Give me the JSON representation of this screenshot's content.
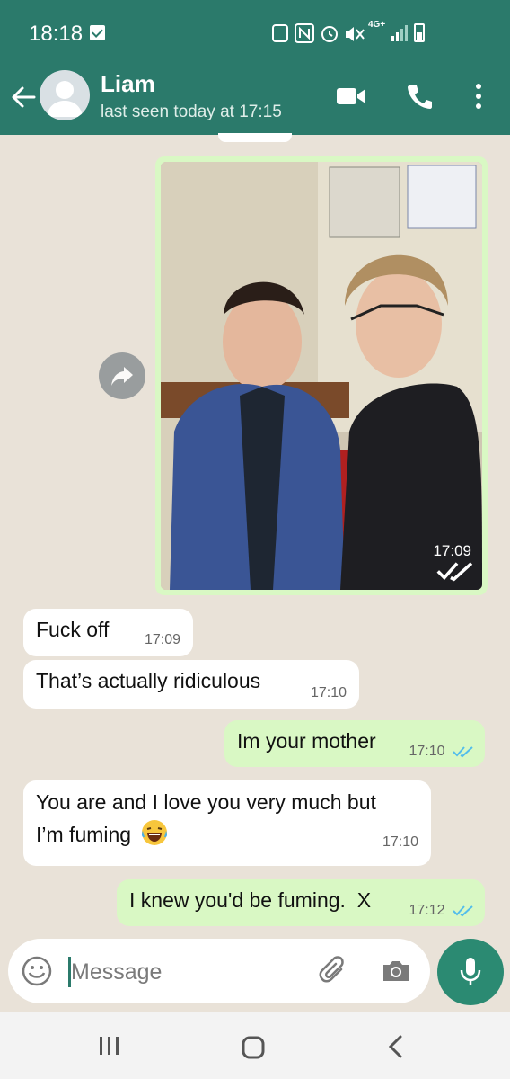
{
  "status_bar": {
    "time": "18:18",
    "network": "4G+"
  },
  "header": {
    "contact_name": "Liam",
    "last_seen": "last seen today at 17:15"
  },
  "messages": [
    {
      "id": "photo",
      "direction": "outgoing",
      "type": "image",
      "time": "17:09",
      "status": "read"
    },
    {
      "id": "m1",
      "direction": "incoming",
      "text": "Fuck off",
      "time": "17:09"
    },
    {
      "id": "m2",
      "direction": "incoming",
      "text": "That’s actually ridiculous",
      "time": "17:10"
    },
    {
      "id": "m3",
      "direction": "outgoing",
      "text": "Im your mother",
      "time": "17:10",
      "status": "read"
    },
    {
      "id": "m4",
      "direction": "incoming",
      "line1": "You are and I love you very much but",
      "line2": "I’m fuming",
      "emoji": "face-with-tears-of-joy",
      "time": "17:10"
    },
    {
      "id": "m5",
      "direction": "outgoing",
      "text": "I knew you'd be fuming.  X",
      "time": "17:12",
      "status": "read"
    }
  ],
  "composer": {
    "placeholder": "Message"
  },
  "colors": {
    "header": "#2b7a6b",
    "outgoing_bubble": "#d9f8c4",
    "incoming_bubble": "#ffffff",
    "chat_background": "#e9e2d8",
    "mic_button": "#2b8a72",
    "read_ticks": "#53bdeb"
  },
  "icons": [
    "back-arrow-icon",
    "avatar-placeholder-icon",
    "video-call-icon",
    "voice-call-icon",
    "more-options-icon",
    "forward-icon",
    "emoji-icon",
    "attach-icon",
    "camera-icon",
    "mic-icon",
    "recent-apps-icon",
    "home-icon",
    "nav-back-icon"
  ]
}
